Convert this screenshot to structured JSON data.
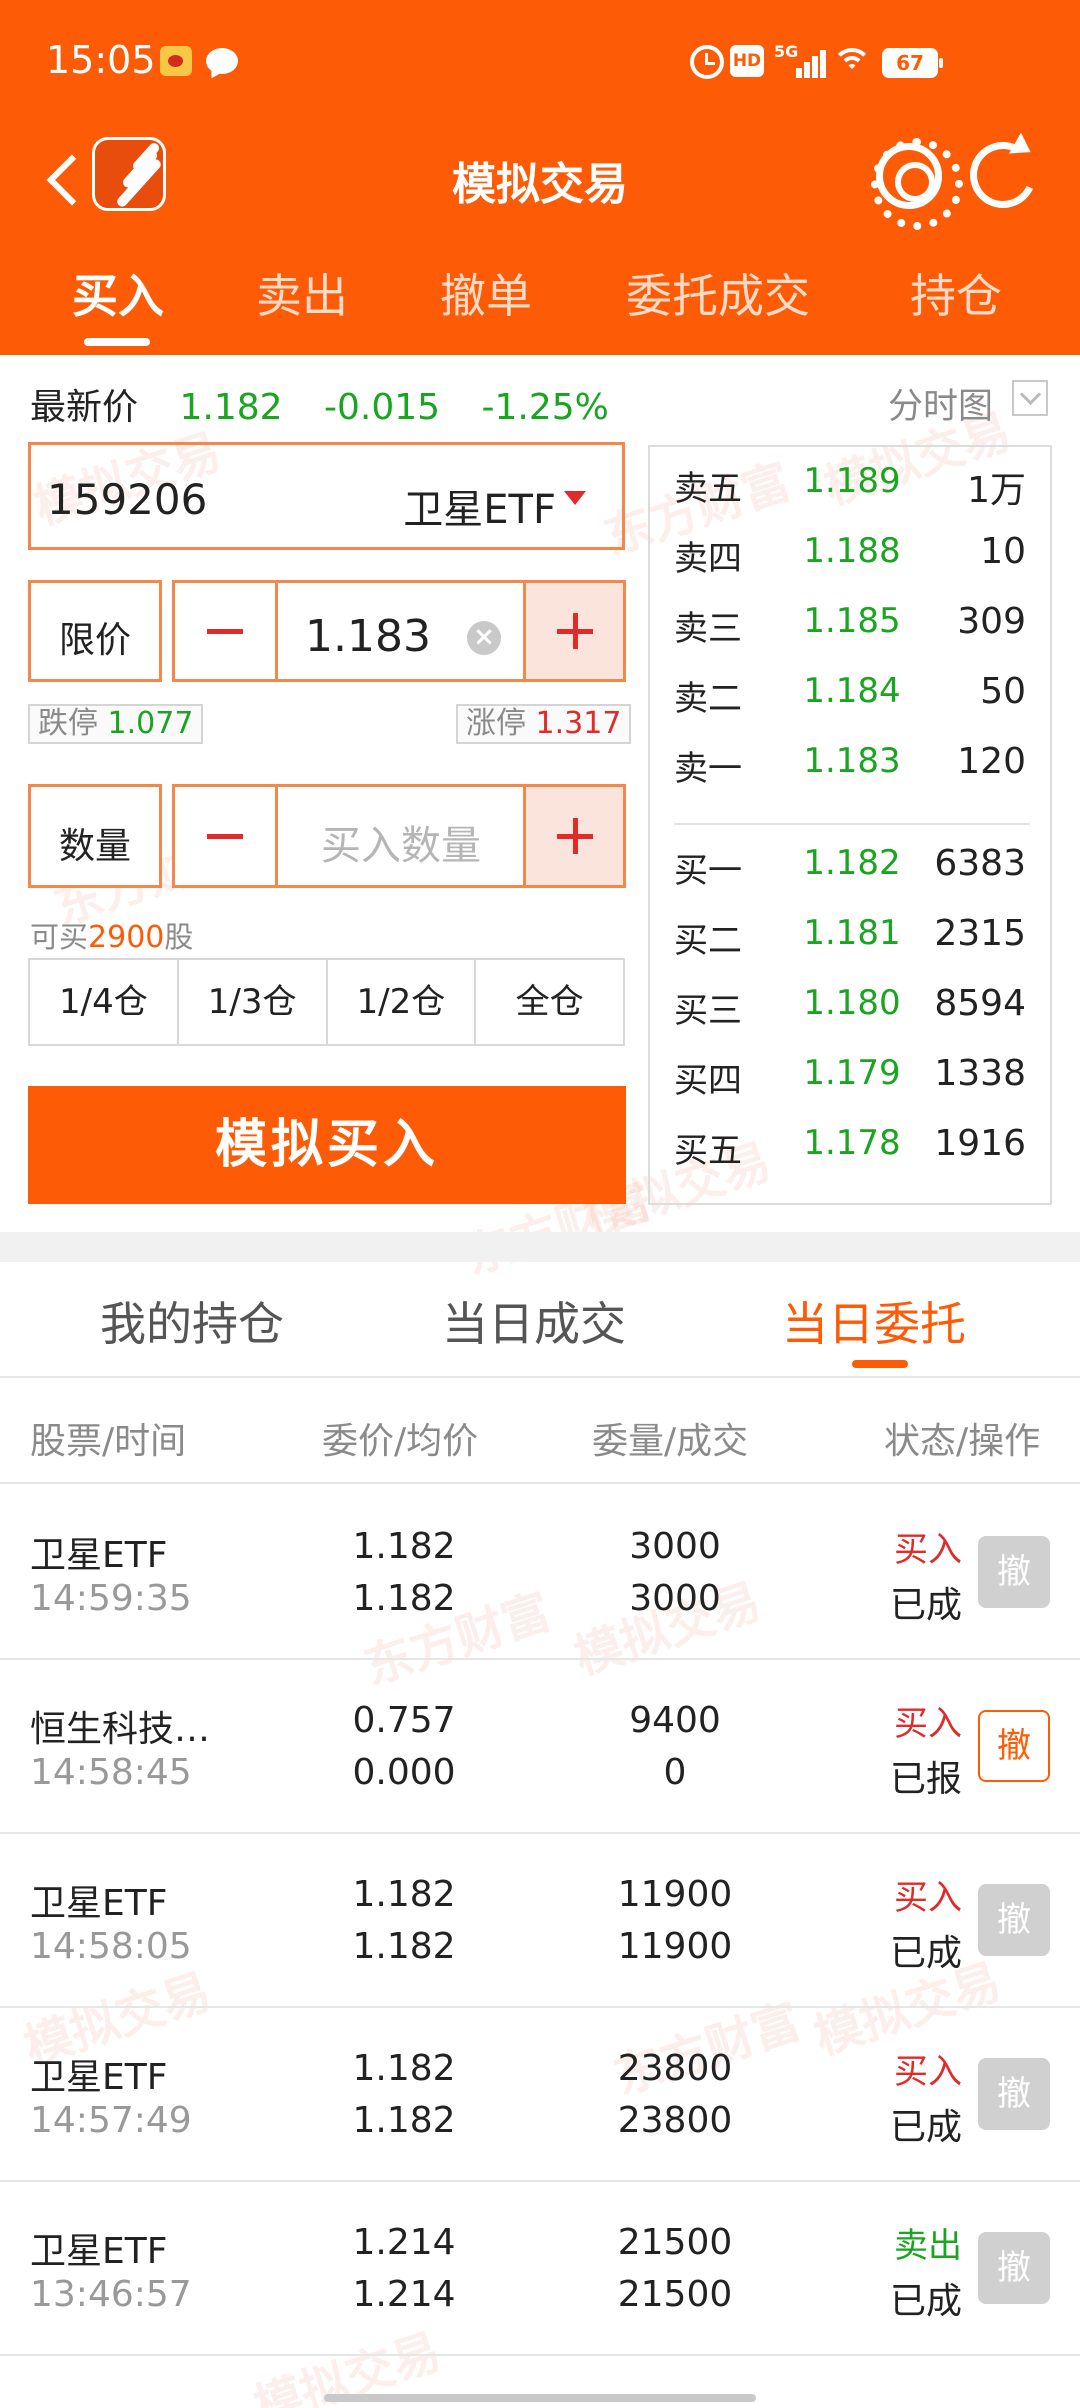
{
  "status_bar": {
    "time": "15:05",
    "battery": "67",
    "network": "5G"
  },
  "header": {
    "title": "模拟交易",
    "tabs": [
      {
        "label": "买入",
        "active": true
      },
      {
        "label": "卖出",
        "active": false
      },
      {
        "label": "撤单",
        "active": false
      },
      {
        "label": "委托成交",
        "active": false
      },
      {
        "label": "持仓",
        "active": false
      }
    ]
  },
  "watermark_text": {
    "brand": "东方财富",
    "mode": "模拟交易"
  },
  "quote": {
    "latest_label": "最新价",
    "latest_price": "1.182",
    "change": "-0.015",
    "change_pct": "-1.25%",
    "chart_link": "分时图"
  },
  "stock": {
    "code": "159206",
    "name": "卫星ETF"
  },
  "price_input": {
    "type_label": "限价",
    "value": "1.183",
    "limit_down_label": "跌停",
    "limit_down": "1.077",
    "limit_up_label": "涨停",
    "limit_up": "1.317"
  },
  "quantity_input": {
    "label": "数量",
    "placeholder": "买入数量",
    "can_buy_prefix": "可买",
    "can_buy": "2900",
    "can_buy_suffix": "股"
  },
  "position_buttons": [
    "1/4仓",
    "1/3仓",
    "1/2仓",
    "全仓"
  ],
  "buy_button": "模拟买入",
  "order_book": {
    "asks": [
      {
        "label": "卖五",
        "price": "1.189",
        "volume": "1万"
      },
      {
        "label": "卖四",
        "price": "1.188",
        "volume": "10"
      },
      {
        "label": "卖三",
        "price": "1.185",
        "volume": "309"
      },
      {
        "label": "卖二",
        "price": "1.184",
        "volume": "50"
      },
      {
        "label": "卖一",
        "price": "1.183",
        "volume": "120"
      }
    ],
    "bids": [
      {
        "label": "买一",
        "price": "1.182",
        "volume": "6383"
      },
      {
        "label": "买二",
        "price": "1.181",
        "volume": "2315"
      },
      {
        "label": "买三",
        "price": "1.180",
        "volume": "8594"
      },
      {
        "label": "买四",
        "price": "1.179",
        "volume": "1338"
      },
      {
        "label": "买五",
        "price": "1.178",
        "volume": "1916"
      }
    ]
  },
  "sub_tabs": [
    {
      "label": "我的持仓",
      "active": false
    },
    {
      "label": "当日成交",
      "active": false
    },
    {
      "label": "当日委托",
      "active": true
    }
  ],
  "orders_table": {
    "headers": [
      "股票/时间",
      "委价/均价",
      "委量/成交",
      "状态/操作"
    ],
    "cancel_label": "撤",
    "rows": [
      {
        "name": "卫星ETF",
        "time": "14:59:35",
        "order_price": "1.182",
        "avg_price": "1.182",
        "order_qty": "3000",
        "filled_qty": "3000",
        "side": "买入",
        "status": "已成",
        "cancellable": false
      },
      {
        "name": "恒生科技…",
        "time": "14:58:45",
        "order_price": "0.757",
        "avg_price": "0.000",
        "order_qty": "9400",
        "filled_qty": "0",
        "side": "买入",
        "status": "已报",
        "cancellable": true
      },
      {
        "name": "卫星ETF",
        "time": "14:58:05",
        "order_price": "1.182",
        "avg_price": "1.182",
        "order_qty": "11900",
        "filled_qty": "11900",
        "side": "买入",
        "status": "已成",
        "cancellable": false
      },
      {
        "name": "卫星ETF",
        "time": "14:57:49",
        "order_price": "1.182",
        "avg_price": "1.182",
        "order_qty": "23800",
        "filled_qty": "23800",
        "side": "买入",
        "status": "已成",
        "cancellable": false
      },
      {
        "name": "卫星ETF",
        "time": "13:46:57",
        "order_price": "1.214",
        "avg_price": "1.214",
        "order_qty": "21500",
        "filled_qty": "21500",
        "side": "卖出",
        "status": "已成",
        "cancellable": false
      }
    ]
  },
  "colors": {
    "brand": "#fe5b06",
    "down": "#19a51f",
    "up": "#e02b2b"
  }
}
